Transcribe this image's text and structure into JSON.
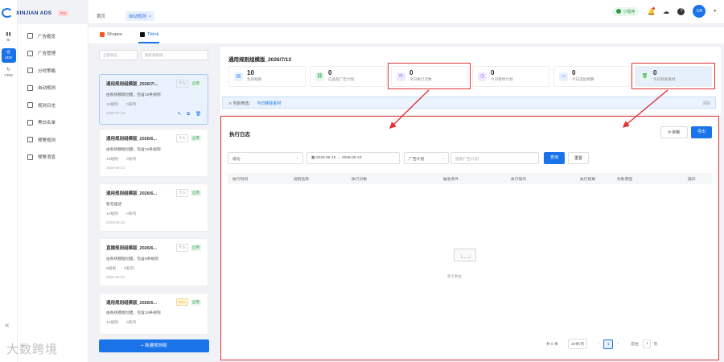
{
  "brand": {
    "name": "XINJIAN ADS",
    "pro": "Pro"
  },
  "rail": [
    {
      "glyph": "▮▮",
      "label": "BI"
    },
    {
      "glyph": "◎",
      "label": "ADS"
    },
    {
      "glyph": "↻",
      "label": "CRM"
    }
  ],
  "rail_collapse": "«",
  "watermark": "大数跨境",
  "menu": [
    "广告概览",
    "广告管理",
    "分时策略",
    "自动规则",
    "规则日志",
    "黑白名单",
    "预警规则",
    "预警消息"
  ],
  "topbar": {
    "home_tab": "首页",
    "active_tab": "自动规则",
    "close": "×",
    "mini": "小程序",
    "avatar": "GR",
    "caret": "▾",
    "icons": {
      "bell": "🔔",
      "cloud": "☁",
      "help": "?"
    }
  },
  "platform_tabs": [
    "Shopee",
    "Tiktok"
  ],
  "list": {
    "filter_select": "全部状态",
    "filter_search": "搜索规则组...",
    "new_button": "+ 新建规则组",
    "cards": [
      {
        "title": "通用规则组模版_2026/7/...",
        "type": "个人",
        "status": "启用",
        "desc": "由系统模版创建，包含10条规则",
        "rules": "10规则",
        "series": "0系列",
        "date": "2026-07-13",
        "actions": [
          "✎",
          "⧉",
          "🗑"
        ]
      },
      {
        "title": "通用规则组模版_2026/6...",
        "type": "个人",
        "status": "启用",
        "desc": "由系统模版创建，包含10条规则",
        "rules": "10规则",
        "series": "0系列",
        "date": "2026-06-23"
      },
      {
        "title": "通用规则组模版_2026/6...",
        "type": "个人",
        "status": "启用",
        "desc": "暂无描述",
        "rules": "10规则",
        "series": "0系列",
        "date": "2026-06-23"
      },
      {
        "title": "直播规则组模版_2026/6...",
        "type": "个人",
        "status": "启用",
        "desc": "由系统模版创建，包含8条规则",
        "rules": "8规则",
        "series": "0系列",
        "date": "2026-06-23"
      },
      {
        "title": "通用规则组模版_2026/6...",
        "type": "DSA",
        "status": "启用",
        "desc": "由系统模版创建，包含10条规则",
        "rules": "10规则",
        "series": "0系列",
        "date": ""
      }
    ]
  },
  "header": {
    "title": "通用规则组模版_2026/7/13",
    "stats": [
      {
        "num": "10",
        "label": "生效规则",
        "icon": "▤",
        "color": "#4a8ef0",
        "bg": "#e7f0fd"
      },
      {
        "num": "0",
        "label": "已监控广告计划",
        "icon": "⛓",
        "color": "#2a9d4b",
        "bg": "#e7f6ec"
      },
      {
        "num": "0",
        "label": "今日执行次数",
        "icon": "⟳",
        "color": "#8a5cf0",
        "bg": "#efe9fd"
      },
      {
        "num": "0",
        "label": "今日暂停计划",
        "icon": "◷",
        "color": "#8a5cf0",
        "bg": "#efe9fd"
      },
      {
        "num": "0",
        "label": "今日追加预算",
        "icon": "▭",
        "color": "#4a8ef0",
        "bg": "#e7f0fd"
      },
      {
        "num": "0",
        "label": "今日移除素材",
        "icon": "🗑",
        "color": "#2a9d4b",
        "bg": "#e7f6ec"
      }
    ],
    "hint_prefix": "当前筛选：",
    "hint_link": "今日移除素材",
    "hint_clear": "清除"
  },
  "log": {
    "title": "执行日志",
    "refresh": "⟳ 刷新",
    "export": "导出",
    "status_filter": "成功",
    "date_from": "2026-06-10",
    "date_sep": "→",
    "date_to": "2026-06-10",
    "plan_select": "广告计划",
    "search_placeholder": "搜索广告计划",
    "query": "查询",
    "reset": "重置",
    "columns": [
      "执行时间",
      "规则名称",
      "执行对象",
      "触发条件",
      "执行操作",
      "执行结果",
      "失败原因",
      "操作"
    ],
    "empty": "暂无数据",
    "pager": {
      "total": "共 0 条",
      "page_size": "20条/页",
      "prev": "‹",
      "page": "1",
      "next": "›",
      "goto_label": "前往",
      "goto_page": "1",
      "goto_suffix": "页"
    }
  }
}
